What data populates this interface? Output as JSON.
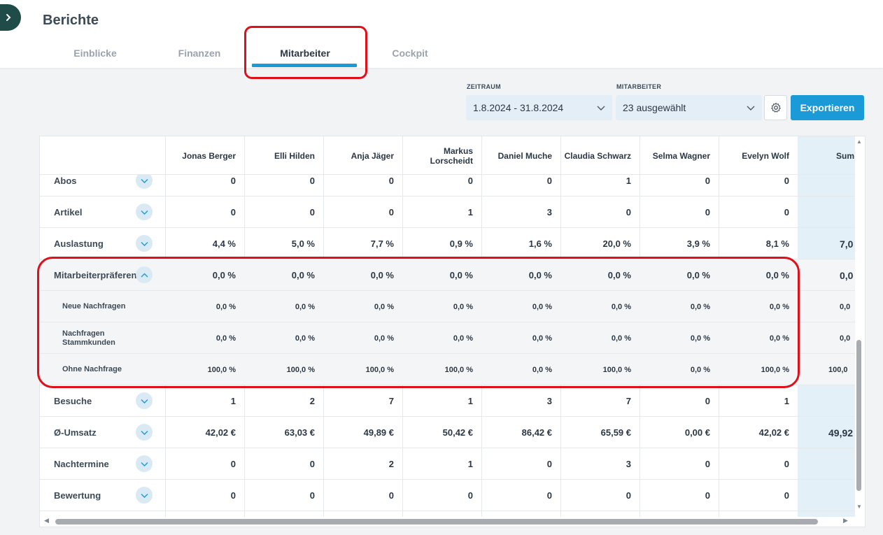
{
  "page": {
    "title": "Berichte"
  },
  "tabs": [
    {
      "label": "Einblicke",
      "active": false
    },
    {
      "label": "Finanzen",
      "active": false
    },
    {
      "label": "Mitarbeiter",
      "active": true
    },
    {
      "label": "Cockpit",
      "active": false
    }
  ],
  "filters": {
    "zeitraum_label": "ZEITRAUM",
    "zeitraum_value": "1.8.2024 - 31.8.2024",
    "mitarbeiter_label": "MITARBEITER",
    "mitarbeiter_value": "23 ausgewählt",
    "export_label": "Exportieren"
  },
  "table": {
    "columns": [
      "Jonas Berger",
      "Elli Hilden",
      "Anja Jäger",
      "Markus Lorscheidt",
      "Daniel Muche",
      "Claudia Schwarz",
      "Selma Wagner",
      "Evelyn Wolf"
    ],
    "sum_header": "Sum",
    "rows": [
      {
        "label": "Abos",
        "values": [
          "0",
          "0",
          "0",
          "0",
          "0",
          "1",
          "0",
          "0"
        ],
        "sum": "",
        "type": "main",
        "expanded": false
      },
      {
        "label": "Artikel",
        "values": [
          "0",
          "0",
          "0",
          "1",
          "3",
          "0",
          "0",
          "0"
        ],
        "sum": "",
        "type": "main",
        "expanded": false
      },
      {
        "label": "Auslastung",
        "values": [
          "4,4 %",
          "5,0 %",
          "7,7 %",
          "0,9 %",
          "1,6 %",
          "20,0 %",
          "3,9 %",
          "8,1 %"
        ],
        "sum": "7,0",
        "type": "main",
        "expanded": false
      },
      {
        "label": "Mitarbeiterpräferenz",
        "values": [
          "0,0 %",
          "0,0 %",
          "0,0 %",
          "0,0 %",
          "0,0 %",
          "0,0 %",
          "0,0 %",
          "0,0 %"
        ],
        "sum": "0,0",
        "type": "main",
        "expanded": true
      },
      {
        "label": "Neue Nachfragen",
        "values": [
          "0,0 %",
          "0,0 %",
          "0,0 %",
          "0,0 %",
          "0,0 %",
          "0,0 %",
          "0,0 %",
          "0,0 %"
        ],
        "sum": "0,0",
        "type": "sub"
      },
      {
        "label": "Nachfragen Stammkunden",
        "values": [
          "0,0 %",
          "0,0 %",
          "0,0 %",
          "0,0 %",
          "0,0 %",
          "0,0 %",
          "0,0 %",
          "0,0 %"
        ],
        "sum": "0,0",
        "type": "sub"
      },
      {
        "label": "Ohne Nachfrage",
        "values": [
          "100,0 %",
          "100,0 %",
          "100,0 %",
          "100,0 %",
          "0,0 %",
          "100,0 %",
          "0,0 %",
          "100,0 %"
        ],
        "sum": "100,0",
        "type": "sub"
      },
      {
        "label": "Besuche",
        "values": [
          "1",
          "2",
          "7",
          "1",
          "3",
          "7",
          "0",
          "1"
        ],
        "sum": "",
        "type": "main",
        "expanded": false
      },
      {
        "label": "Ø-Umsatz",
        "values": [
          "42,02 €",
          "63,03 €",
          "49,89 €",
          "50,42 €",
          "86,42 €",
          "65,59 €",
          "0,00 €",
          "42,02 €"
        ],
        "sum": "49,92",
        "type": "main",
        "expanded": false
      },
      {
        "label": "Nachtermine",
        "values": [
          "0",
          "0",
          "2",
          "1",
          "0",
          "3",
          "0",
          "0"
        ],
        "sum": "",
        "type": "main",
        "expanded": false
      },
      {
        "label": "Bewertung",
        "values": [
          "0",
          "0",
          "0",
          "0",
          "0",
          "0",
          "0",
          "0"
        ],
        "sum": "",
        "type": "main",
        "expanded": false
      }
    ]
  },
  "colors": {
    "accent": "#1a9ad6",
    "highlight": "#e0101a",
    "sidebar": "#1f4c48"
  }
}
